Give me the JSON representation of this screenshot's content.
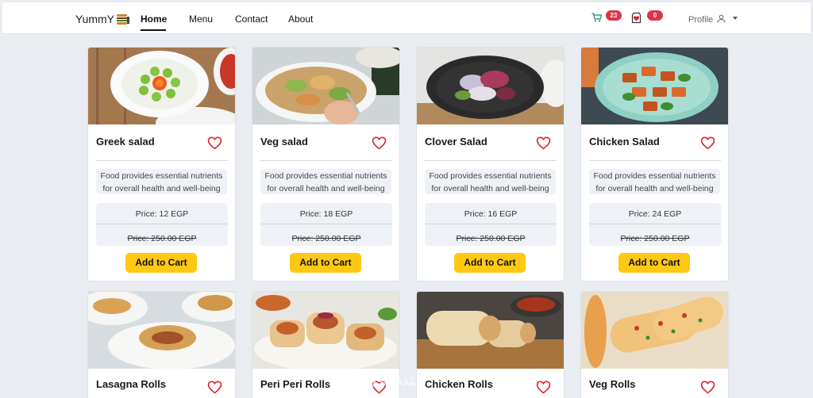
{
  "nav": {
    "brand": "YummY",
    "links": [
      "Home",
      "Menu",
      "Contact",
      "About"
    ],
    "active_index": 0,
    "cart_count": "23",
    "wishlist_count": "0",
    "profile_label": "Profile"
  },
  "icons": {
    "cart": "shopping-cart-icon",
    "wishlist": "heart-box-icon",
    "profile": "user-icon",
    "heart": "heart-outline-icon"
  },
  "colors": {
    "accent_yellow": "#ffc812",
    "badge_red": "#dc3545",
    "heart_red": "#d9252b",
    "cart_green": "#2e9d8f"
  },
  "products": [
    {
      "name": "Greek salad",
      "description_line1": "Food provides essential nutrients",
      "description_line2": "for overall health and well-being",
      "price": "Price: 12 EGP",
      "old_price": "Price: 250.00 EGP",
      "button": "Add to Cart"
    },
    {
      "name": "Veg salad",
      "description_line1": "Food provides essential nutrients",
      "description_line2": "for overall health and well-being",
      "price": "Price: 18 EGP",
      "old_price": "Price: 250.00 EGP",
      "button": "Add to Cart"
    },
    {
      "name": "Clover Salad",
      "description_line1": "Food provides essential nutrients",
      "description_line2": "for overall health and well-being",
      "price": "Price: 16 EGP",
      "old_price": "Price: 250.00 EGP",
      "button": "Add to Cart"
    },
    {
      "name": "Chicken Salad",
      "description_line1": "Food provides essential nutrients",
      "description_line2": "for overall health and well-being",
      "price": "Price: 24 EGP",
      "old_price": "Price: 250.00 EGP",
      "button": "Add to Cart"
    },
    {
      "name": "Lasagna Rolls"
    },
    {
      "name": "Peri Peri Rolls"
    },
    {
      "name": "Chicken Rolls"
    },
    {
      "name": "Veg Rolls"
    }
  ],
  "watermark": "مستقل"
}
